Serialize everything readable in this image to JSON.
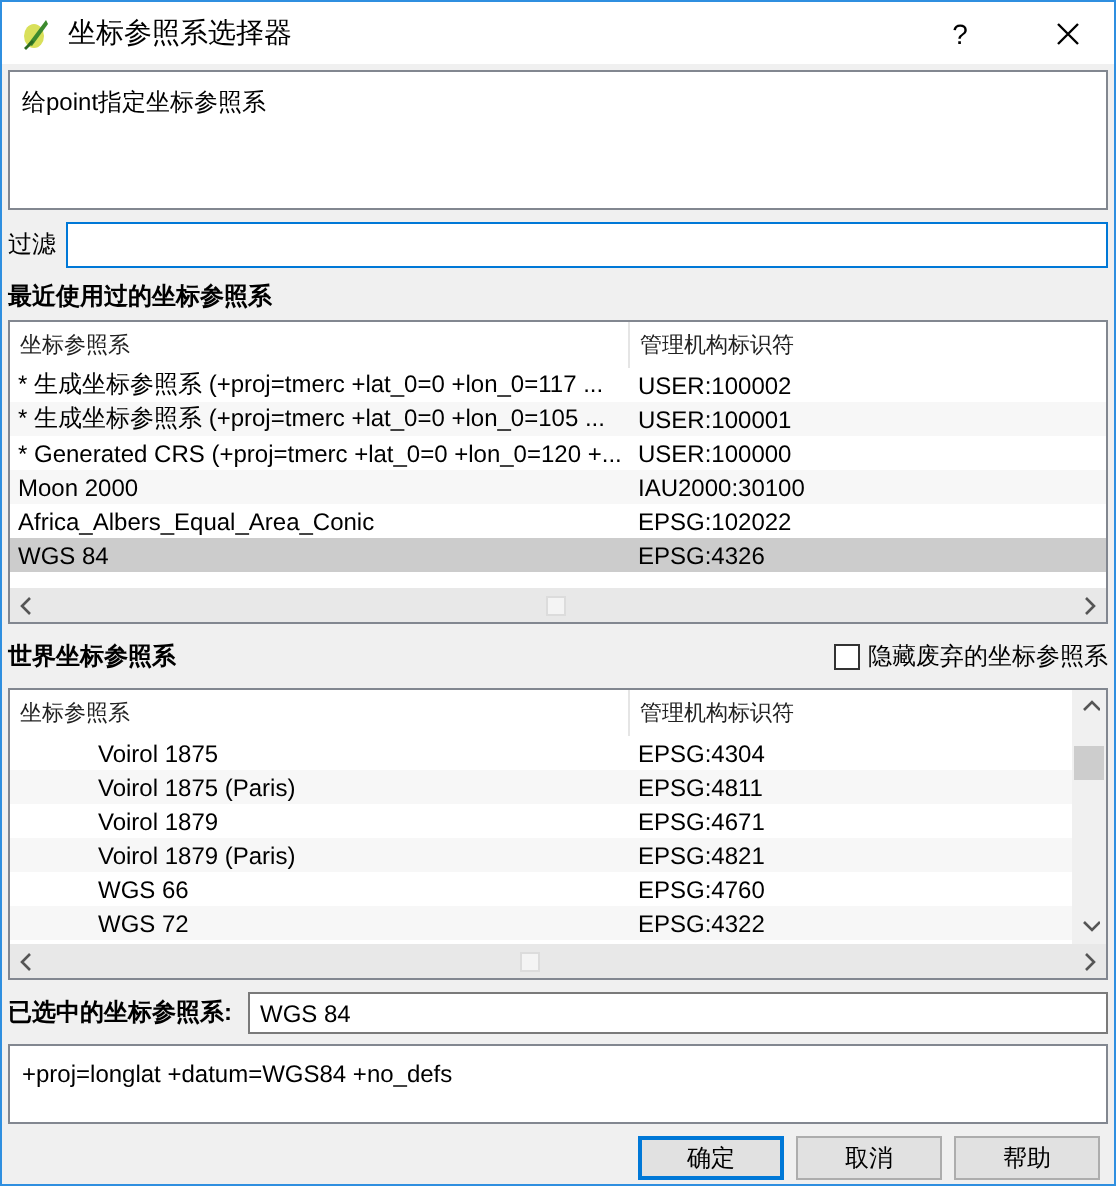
{
  "window": {
    "title": "坐标参照系选择器",
    "help_button": "?"
  },
  "description": "给point指定坐标参照系",
  "filter": {
    "label": "过滤"
  },
  "recent": {
    "title": "最近使用过的坐标参照系",
    "columns": [
      "坐标参照系",
      "管理机构标识符"
    ],
    "rows": [
      {
        "name": "* 生成坐标参照系 (+proj=tmerc +lat_0=0 +lon_0=117 ...",
        "authority_id": "USER:100002",
        "selected": false
      },
      {
        "name": "* 生成坐标参照系 (+proj=tmerc +lat_0=0 +lon_0=105 ...",
        "authority_id": "USER:100001",
        "selected": false
      },
      {
        "name": "* Generated CRS (+proj=tmerc +lat_0=0 +lon_0=120 +...",
        "authority_id": "USER:100000",
        "selected": false
      },
      {
        "name": "Moon 2000",
        "authority_id": "IAU2000:30100",
        "selected": false
      },
      {
        "name": "Africa_Albers_Equal_Area_Conic",
        "authority_id": "EPSG:102022",
        "selected": false
      },
      {
        "name": "WGS 84",
        "authority_id": "EPSG:4326",
        "selected": true
      }
    ]
  },
  "world": {
    "title": "世界坐标参照系",
    "hide_deprecated": {
      "label": "隐藏废弃的坐标参照系",
      "checked": false
    },
    "columns": [
      "坐标参照系",
      "管理机构标识符"
    ],
    "rows": [
      {
        "name": "Voirol 1875",
        "authority_id": "EPSG:4304",
        "selected": false
      },
      {
        "name": "Voirol 1875 (Paris)",
        "authority_id": "EPSG:4811",
        "selected": false
      },
      {
        "name": "Voirol 1879",
        "authority_id": "EPSG:4671",
        "selected": false
      },
      {
        "name": "Voirol 1879 (Paris)",
        "authority_id": "EPSG:4821",
        "selected": false
      },
      {
        "name": "WGS 66",
        "authority_id": "EPSG:4760",
        "selected": false
      },
      {
        "name": "WGS 72",
        "authority_id": "EPSG:4322",
        "selected": false
      }
    ]
  },
  "selected_crs": {
    "label": "已选中的坐标参照系:",
    "value": "WGS 84"
  },
  "proj_definition": "+proj=longlat +datum=WGS84 +no_defs",
  "buttons": [
    {
      "label": "确定",
      "default": true
    },
    {
      "label": "取消",
      "default": false
    },
    {
      "label": "帮助",
      "default": false
    }
  ]
}
